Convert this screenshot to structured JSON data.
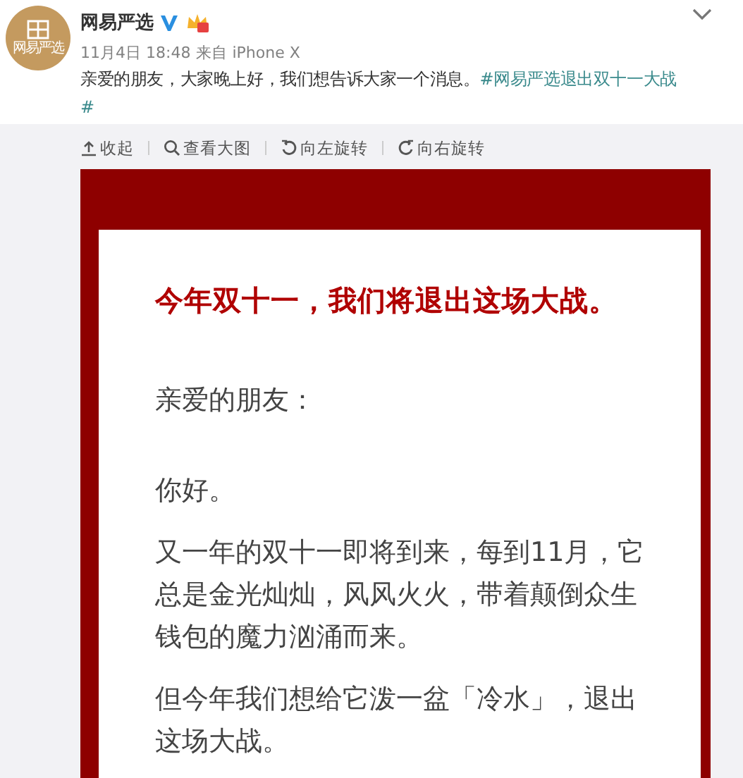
{
  "post": {
    "author": "网易严选",
    "verified": true,
    "avatar_text": "网易严选",
    "time": "11月4日 18:48",
    "source_prefix": "来自",
    "source": "iPhone X",
    "text": "亲爱的朋友，大家晚上好，我们想告诉大家一个消息。",
    "hashtag": "#网易严选退出双十一大战",
    "hashtag_end": "#"
  },
  "image_toolbar": [
    {
      "kind": "collapse",
      "label": "收起"
    },
    {
      "kind": "zoom",
      "label": "查看大图"
    },
    {
      "kind": "rotate_left",
      "label": "向左旋转"
    },
    {
      "kind": "rotate_right",
      "label": "向右旋转"
    }
  ],
  "image": {
    "headline": "今年双十一，我们将退出这场大战。",
    "greeting": "亲爱的朋友：",
    "paragraphs": [
      "你好。",
      "又一年的双十一即将到来，每到11月，它总是金光灿灿，风风火火，带着颠倒众生钱包的魔力汹涌而来。",
      "但今年我们想给它泼一盆「冷水」，退出这场大战。"
    ]
  }
}
